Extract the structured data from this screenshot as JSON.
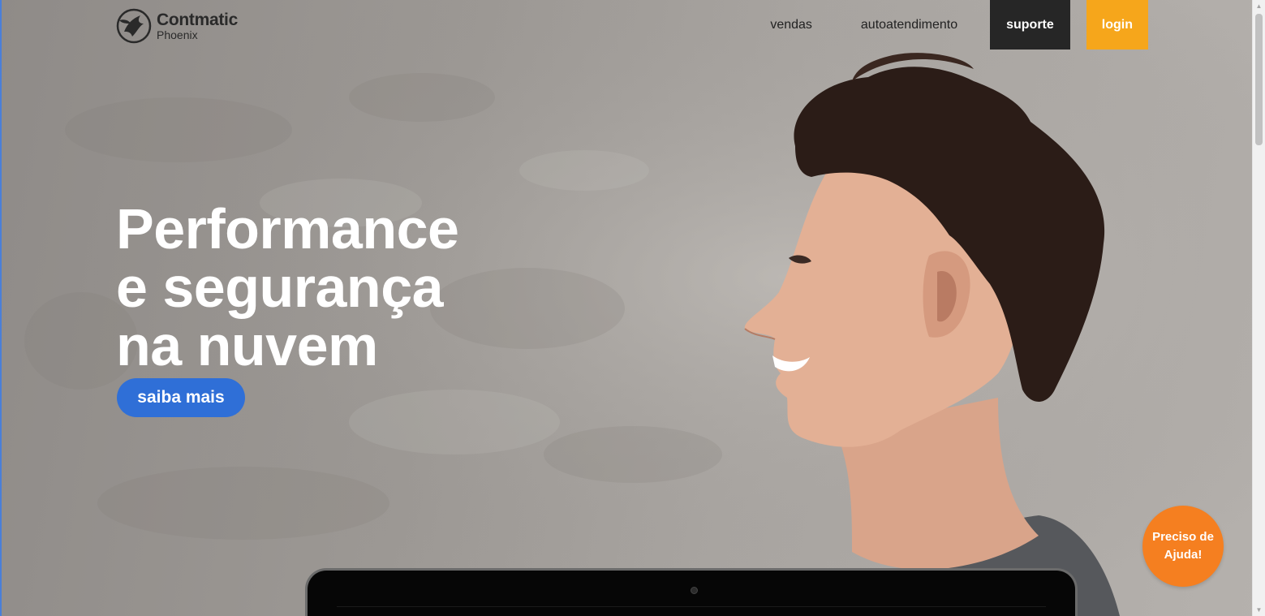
{
  "brand": {
    "name": "Contmatic",
    "sub": "Phoenix",
    "logo_icon": "phoenix-icon"
  },
  "nav": {
    "items": [
      {
        "label": "vendas"
      },
      {
        "label": "autoatendimento"
      },
      {
        "label": "suporte"
      },
      {
        "label": "login"
      }
    ]
  },
  "hero": {
    "line1": "Performance",
    "line2": "e segurança",
    "line3": "na nuvem",
    "cta_label": "saiba mais"
  },
  "help": {
    "label": "Preciso de Ajuda!"
  },
  "colors": {
    "cta": "#2f6fd7",
    "support": "#262626",
    "login": "#f6a61b",
    "help": "#f57f20"
  }
}
